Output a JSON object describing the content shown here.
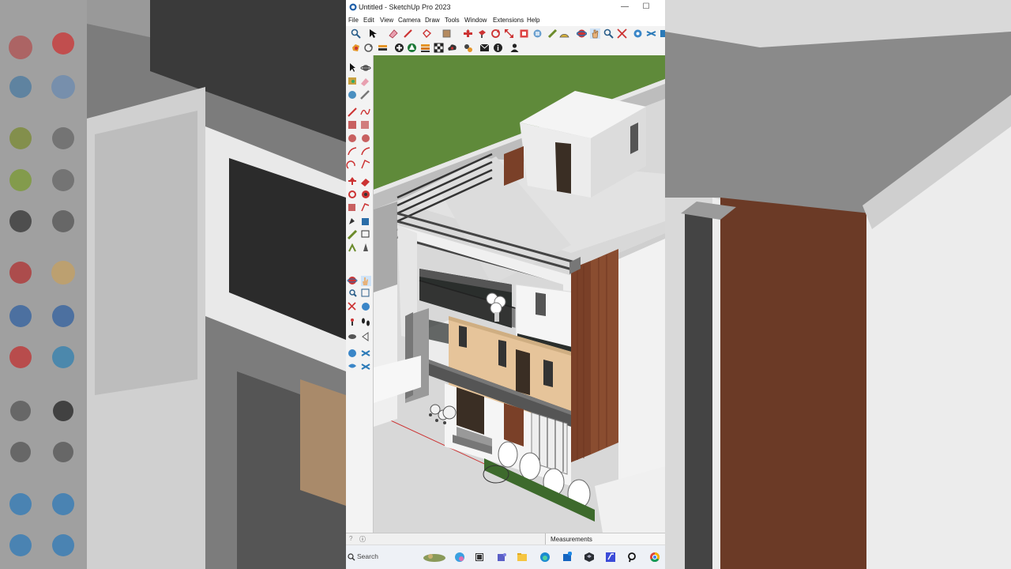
{
  "window": {
    "title": "Untitled - SketchUp Pro 2023",
    "minimize_glyph": "—",
    "maximize_glyph": "☐"
  },
  "menu": [
    "File",
    "Edit",
    "View",
    "Camera",
    "Draw",
    "Tools",
    "Window",
    "Extensions",
    "Help"
  ],
  "toolbar_top": {
    "icons": [
      "zoom-icon",
      "select-icon",
      "eraser-icon",
      "pencil-icon",
      "shape-icon",
      "paint-icon",
      "move-icon",
      "push-pull-icon",
      "rotate-icon",
      "scale-icon",
      "offset-icon",
      "follow-me-icon",
      "tape-icon",
      "protractor-icon",
      "orbit-icon",
      "pan-icon",
      "zoom-window-icon",
      "zoom-extents-icon",
      "section-icon",
      "sandbox-icon"
    ]
  },
  "toolbar_second": {
    "icons": [
      "warehouse-icon",
      "refresh-icon",
      "components-icon",
      "add-location-icon",
      "tree-icon",
      "layers-icon",
      "checker-icon",
      "cloud-icon",
      "extension-icon",
      "mail-icon",
      "info-icon",
      "user-icon"
    ]
  },
  "left_toolbar": {
    "icons": [
      "select-icon",
      "orbit-icon",
      "paint-bucket-icon",
      "eraser-icon",
      "tag-icon",
      "pencil-icon",
      "line-icon",
      "freehand-icon",
      "rectangle-icon",
      "rotated-rectangle-icon",
      "circle-icon",
      "polygon-icon",
      "arc-icon",
      "pie-icon",
      "arc-2pt-icon",
      "arc-3pt-icon",
      "move-icon",
      "push-pull-icon",
      "rotate-icon",
      "follow-me-icon",
      "scale-icon",
      "offset-icon",
      "tape-measure-icon",
      "dimension-icon",
      "protractor-icon",
      "text-icon",
      "axes-icon",
      "3d-text-icon",
      "orbit-view-icon",
      "pan-view-icon",
      "zoom-icon",
      "zoom-window-icon",
      "zoom-extents-icon",
      "previous-view-icon",
      "position-camera-icon",
      "walk-icon",
      "look-around-icon",
      "section-plane-icon",
      "sandbox-scratch-icon",
      "sandbox-contours-icon",
      "smoove-icon",
      "stamp-icon"
    ]
  },
  "status": {
    "measurements_label": "Measurements",
    "info_glyph": "ⓘ",
    "hint_glyph": "?"
  },
  "taskbar": {
    "search_placeholder": "Search",
    "icons": [
      "search-icon",
      "weather-icon",
      "copilot-icon",
      "task-view-icon",
      "teams-icon",
      "file-explorer-icon",
      "edge-icon",
      "store-icon",
      "sketchup-icon",
      "visual-studio-icon",
      "pinterest-icon",
      "chrome-icon"
    ]
  },
  "colors": {
    "grass": "#5f8a3a",
    "wood": "#7a4028",
    "beige": "#e6c49a",
    "wall": "#f4f4f4",
    "rail": "#4a4a4a"
  }
}
